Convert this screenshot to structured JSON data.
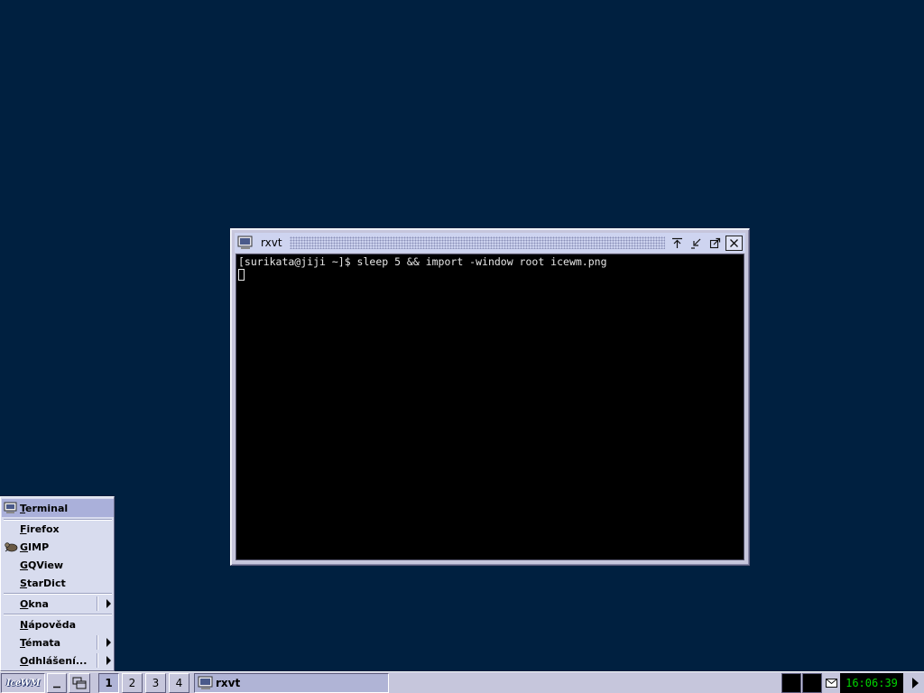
{
  "desktop": {
    "background": "#002040"
  },
  "window": {
    "title": "rxvt",
    "terminal_lines": [
      "[surikata@jiji ~]$ sleep 5 && import -window root icewm.png"
    ]
  },
  "start_menu": {
    "items": [
      {
        "label_first": "T",
        "label_rest": "erminal",
        "icon": "terminal-icon"
      },
      {
        "label_first": "F",
        "label_rest": "irefox"
      },
      {
        "label_first": "G",
        "label_rest": "IMP",
        "icon": "gimp-icon"
      },
      {
        "label_first": "G",
        "label_rest": "QView"
      },
      {
        "label_first": "S",
        "label_rest": "tarDict"
      },
      {
        "label_first": "O",
        "label_rest": "kna"
      },
      {
        "label_first": "N",
        "label_rest": "ápověda"
      },
      {
        "label_first": "T",
        "label_rest": "émata"
      },
      {
        "label_first": "O",
        "label_rest": "dhlášení..."
      }
    ]
  },
  "taskbar": {
    "start_label": "IceWM",
    "workspaces": [
      "1",
      "2",
      "3",
      "4"
    ],
    "active_workspace": "1",
    "task_label": "rxvt",
    "clock": "16:06:39",
    "clock_color": "#00d400"
  }
}
